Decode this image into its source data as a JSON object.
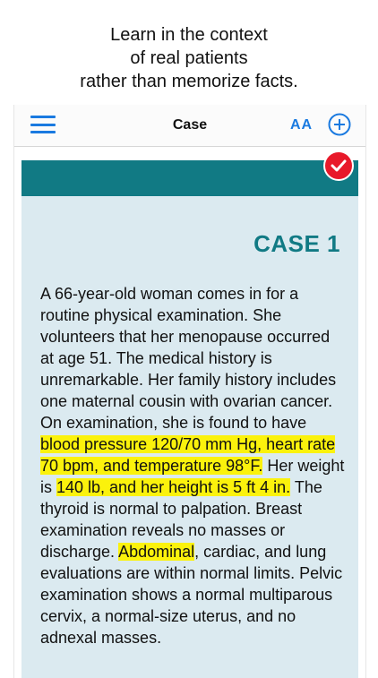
{
  "promo": {
    "lines": [
      "Learn in the context",
      "of real patients",
      "rather than memorize facts."
    ]
  },
  "navbar": {
    "title": "Case",
    "font_size_label": "AA",
    "menu_icon": "hamburger-menu-icon",
    "add_icon": "plus-circle-icon"
  },
  "case": {
    "title": "CASE 1",
    "status_icon": "checkmark-badge-icon",
    "segments": [
      {
        "text": "A 66-year-old woman comes in for a routine physical examination. She volunteers that her menopause occurred at age 51. The medical history is unremarkable. Her family history includes one maternal cousin with ovarian cancer. On examination, she is found to have ",
        "highlight": false
      },
      {
        "text": "blood pressure 120/70 mm Hg, heart rate 70 bpm, and temperature 98°F.",
        "highlight": true
      },
      {
        "text": " Her weight is ",
        "highlight": false
      },
      {
        "text": "140 lb, and her height is 5 ft 4 in.",
        "highlight": true
      },
      {
        "text": " The thyroid is normal to palpation. Breast examination reveals no masses or discharge. ",
        "highlight": false
      },
      {
        "text": "Abdominal",
        "highlight": true
      },
      {
        "text": ", cardiac, and lung evaluations are within normal limits. Pelvic examination shows a normal multiparous cervix, a normal-size uterus, and no adnexal masses.",
        "highlight": false
      }
    ]
  },
  "colors": {
    "accent": "#1a7ae0",
    "header_teal": "#117a84",
    "card_bg": "#dbeaf0",
    "highlight": "#fbf20c",
    "badge_red": "#e8192a"
  }
}
